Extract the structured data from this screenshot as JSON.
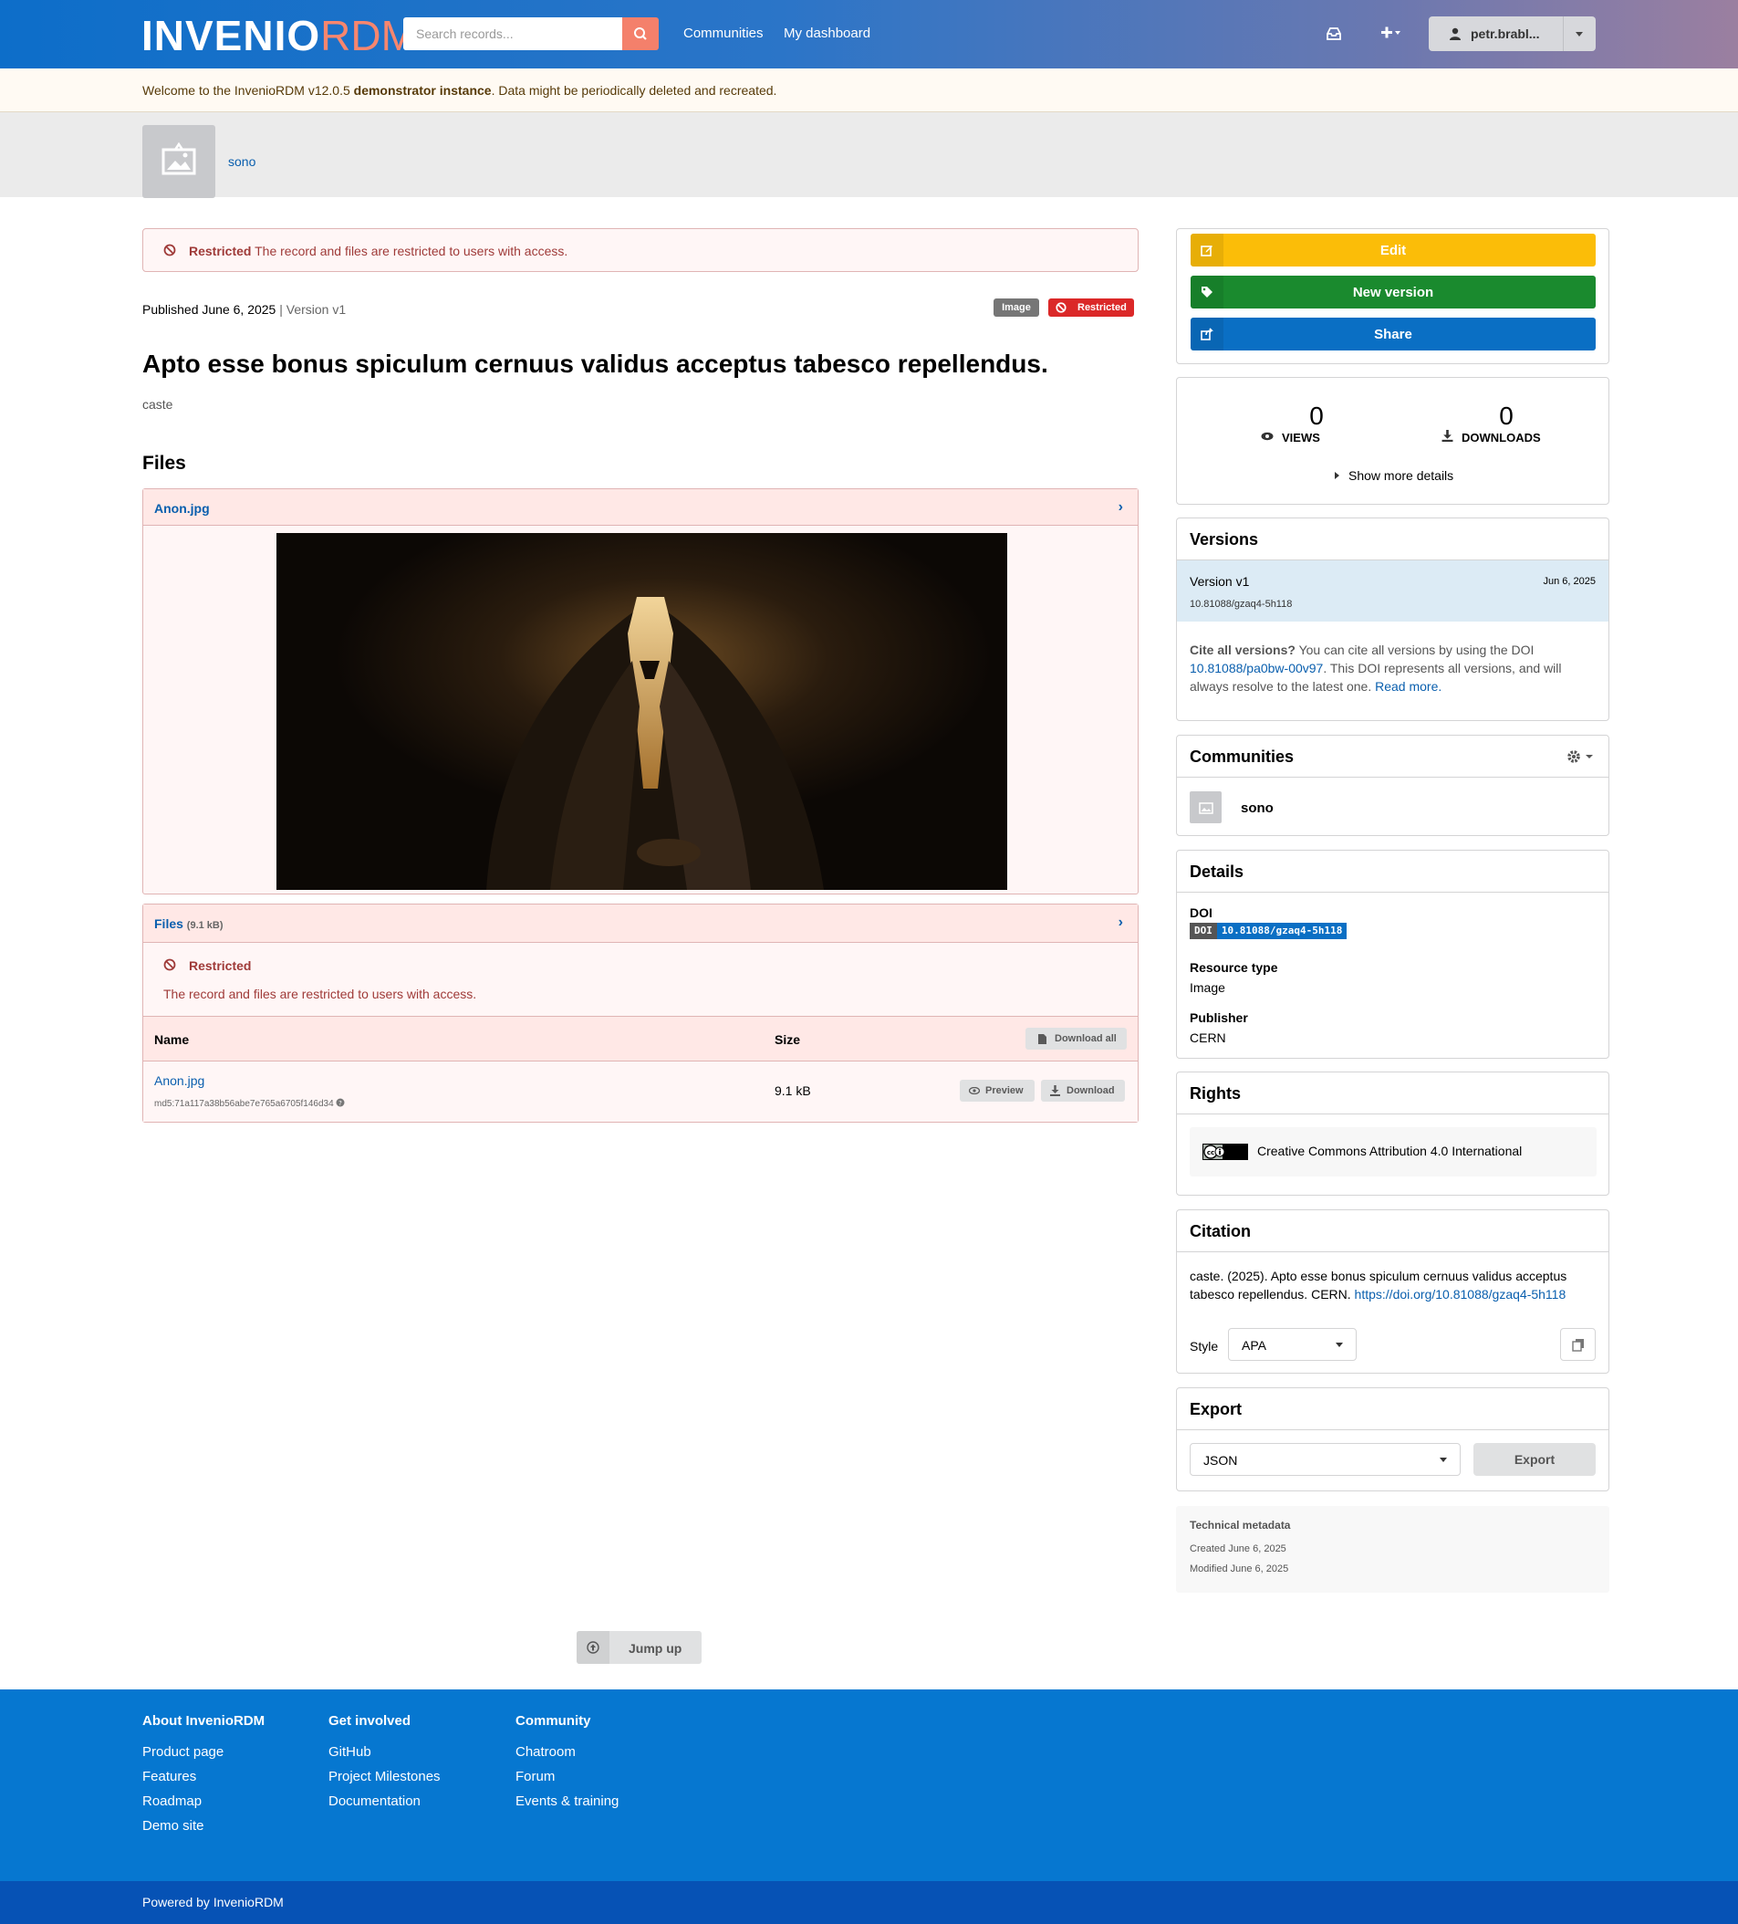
{
  "header": {
    "logo_part1": "INVENIO",
    "logo_part2": "RDM",
    "search_placeholder": "Search records...",
    "nav": [
      "Communities",
      "My dashboard"
    ],
    "user": "petr.brabl..."
  },
  "banner": {
    "prefix": "Welcome to the InvenioRDM v12.0.5 ",
    "bold": "demonstrator instance",
    "suffix": ". Data might be periodically deleted and recreated."
  },
  "community": {
    "name": "sono"
  },
  "record": {
    "restricted_label": "Restricted",
    "restricted_text": "The record and files are restricted to users with access.",
    "published": "Published June 6, 2025",
    "separator": "|",
    "version": "Version v1",
    "badges": {
      "type": "Image",
      "access": "Restricted"
    },
    "title": "Apto esse bonus spiculum cernuus validus acceptus tabesco repellendus.",
    "creator": "caste",
    "files_heading": "Files"
  },
  "preview": {
    "filename": "Anon.jpg"
  },
  "files_panel": {
    "title": "Files",
    "size": "(9.1 kB)",
    "restricted_title": "Restricted",
    "restricted_text": "The record and files are restricted to users with access.",
    "columns": {
      "name": "Name",
      "size": "Size"
    },
    "download_all": "Download all",
    "rows": [
      {
        "name": "Anon.jpg",
        "md5": "md5:71a117a38b56abe7e765a6705f146d34",
        "size": "9.1 kB",
        "preview": "Preview",
        "download": "Download"
      }
    ]
  },
  "actions": {
    "edit": "Edit",
    "new_version": "New version",
    "share": "Share"
  },
  "stats": {
    "views_count": "0",
    "views_label": "VIEWS",
    "downloads_count": "0",
    "downloads_label": "DOWNLOADS",
    "more": "Show more details"
  },
  "versions": {
    "title": "Versions",
    "items": [
      {
        "label": "Version v1",
        "date": "Jun 6, 2025",
        "doi": "10.81088/gzaq4-5h118"
      }
    ],
    "cite_bold": "Cite all versions?",
    "cite_text1": " You can cite all versions by using the DOI ",
    "cite_doi": "10.81088/pa0bw-00v97",
    "cite_text2": ". This DOI represents all versions, and will always resolve to the latest one. ",
    "read_more": "Read more."
  },
  "communities": {
    "title": "Communities",
    "items": [
      "sono"
    ]
  },
  "details": {
    "title": "Details",
    "doi_label": "DOI",
    "doi_badge": "DOI",
    "doi_value": "10.81088/gzaq4-5h118",
    "resource_type_label": "Resource type",
    "resource_type": "Image",
    "publisher_label": "Publisher",
    "publisher": "CERN"
  },
  "rights": {
    "title": "Rights",
    "license": "Creative Commons Attribution 4.0 International"
  },
  "citation": {
    "title": "Citation",
    "text": "caste. (2025). Apto esse bonus spiculum cernuus validus acceptus tabesco repellendus. CERN. ",
    "link": "https://doi.org/10.81088/gzaq4-5h118",
    "style_label": "Style",
    "style_value": "APA"
  },
  "export": {
    "title": "Export",
    "format": "JSON",
    "button": "Export"
  },
  "technical": {
    "title": "Technical metadata",
    "created": "Created June 6, 2025",
    "modified": "Modified June 6, 2025"
  },
  "jump_up": "Jump up",
  "footer": {
    "columns": [
      {
        "title": "About InvenioRDM",
        "links": [
          "Product page",
          "Features",
          "Roadmap",
          "Demo site"
        ]
      },
      {
        "title": "Get involved",
        "links": [
          "GitHub",
          "Project Milestones",
          "Documentation"
        ]
      },
      {
        "title": "Community",
        "links": [
          "Chatroom",
          "Forum",
          "Events & training"
        ]
      }
    ],
    "powered": "Powered by InvenioRDM"
  },
  "colors": {
    "edit": "#fbbd08",
    "new_version": "#1a8a2e",
    "share": "#0a6fc4",
    "restricted": "#db2828",
    "footer": "#0677d0"
  }
}
